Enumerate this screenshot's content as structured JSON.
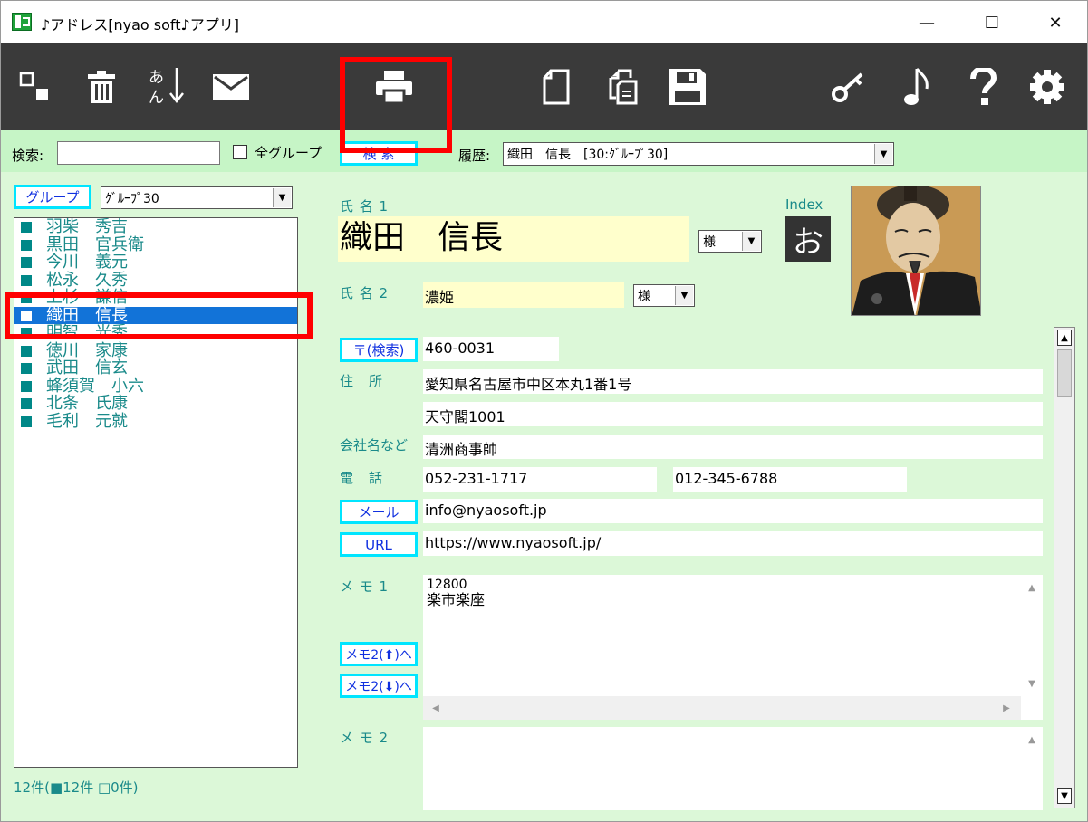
{
  "window": {
    "title": "♪アドレス[nyao soft♪アプリ]",
    "minimize": "—",
    "maximize": "☐",
    "close": "✕"
  },
  "toolbar": {
    "sort_label_top": "あ",
    "sort_label_bottom": "ん"
  },
  "search": {
    "label": "検索:",
    "value": "",
    "all_groups_label": "全グループ",
    "search_button": "検 索",
    "history_label": "履歴:",
    "history_value": "織田　信長　[30:ｸﾞﾙｰﾌﾟ30]"
  },
  "group": {
    "button": "グループ",
    "selected": "ｸﾞﾙｰﾌﾟ30"
  },
  "contacts": [
    {
      "name": "羽柴　秀吉",
      "selected": false
    },
    {
      "name": "黒田　官兵衛",
      "selected": false
    },
    {
      "name": "今川　義元",
      "selected": false
    },
    {
      "name": "松永　久秀",
      "selected": false
    },
    {
      "name": "上杉　謙信",
      "selected": false
    },
    {
      "name": "織田　信長",
      "selected": true
    },
    {
      "name": "明智　光秀",
      "selected": false
    },
    {
      "name": "徳川　家康",
      "selected": false
    },
    {
      "name": "武田　信玄",
      "selected": false
    },
    {
      "name": "蜂須賀　小六",
      "selected": false
    },
    {
      "name": "北条　氏康",
      "selected": false
    },
    {
      "name": "毛利　元就",
      "selected": false
    }
  ],
  "list_status": "12件(■12件 □0件)",
  "form": {
    "name1_label": "氏 名 1",
    "name1_value": "織田　信長",
    "name1_honorific": "様",
    "index_label": "Index",
    "index_value": "お",
    "name2_label": "氏 名 2",
    "name2_value": "濃姫",
    "name2_honorific": "様",
    "zip_button": "〒(検索)",
    "zip_value": "460-0031",
    "address_label": "住　所",
    "address1": "愛知県名古屋市中区本丸1番1号",
    "address2": "天守閣1001",
    "company_label": "会社名など",
    "company_value": "清洲商事帥",
    "phone_label": "電　話",
    "phone1": "052-231-1717",
    "phone2": "012-345-6788",
    "mail_button": "メール",
    "mail_value": "info@nyaosoft.jp",
    "url_button": "URL",
    "url_value": "https://www.nyaosoft.jp/",
    "memo1_label": "メ モ 1",
    "memo1_line1": "12800",
    "memo1_line2": "楽市楽座",
    "memo_up_button": "メモ2(⬆)へ",
    "memo_down_button": "メモ2(⬇)へ",
    "memo2_label": "メ モ 2",
    "memo2_value": ""
  }
}
